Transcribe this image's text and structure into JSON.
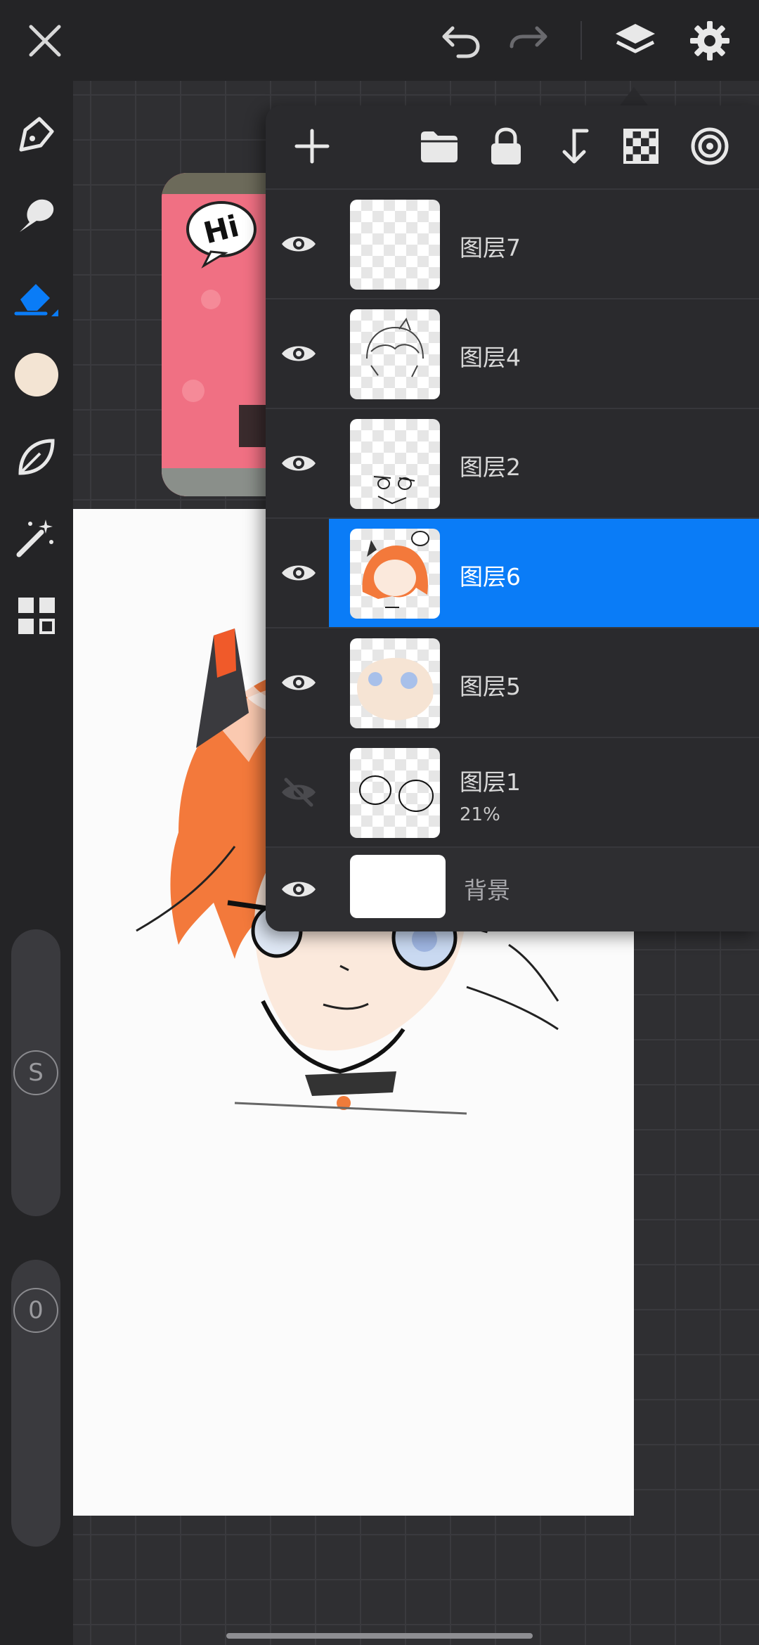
{
  "app": {
    "accent_color": "#0a7cf7",
    "background_color": "#2e2e31"
  },
  "topbar": {
    "close_icon": "close-icon",
    "undo_icon": "undo-icon",
    "redo_icon": "redo-icon",
    "layers_icon": "layers-icon",
    "settings_icon": "settings-icon"
  },
  "sidebar": {
    "tools": [
      "pen-icon",
      "smudge-icon",
      "eraser-icon",
      "color-swatch",
      "leaf-brush-icon",
      "magic-wand-icon",
      "grid-apps-icon"
    ],
    "active_tool": "eraser-icon",
    "current_color": "#f3e4d3",
    "size_slider_label": "S",
    "opacity_slider_label": "0"
  },
  "layers_panel": {
    "toolbar": [
      "add-layer-icon",
      "folder-icon",
      "lock-icon",
      "merge-down-icon",
      "transparency-checker-icon",
      "clipping-mask-icon"
    ],
    "layers": [
      {
        "name": "图层7",
        "visible": true,
        "selected": false,
        "sub": ""
      },
      {
        "name": "图层4",
        "visible": true,
        "selected": false,
        "sub": ""
      },
      {
        "name": "图层2",
        "visible": true,
        "selected": false,
        "sub": ""
      },
      {
        "name": "图层6",
        "visible": true,
        "selected": true,
        "sub": ""
      },
      {
        "name": "图层5",
        "visible": true,
        "selected": false,
        "sub": ""
      },
      {
        "name": "图层1",
        "visible": false,
        "selected": false,
        "sub": "21%"
      },
      {
        "name": "背景",
        "visible": true,
        "selected": false,
        "sub": ""
      }
    ]
  },
  "reference_image": {
    "bubble_text": "Hi"
  }
}
